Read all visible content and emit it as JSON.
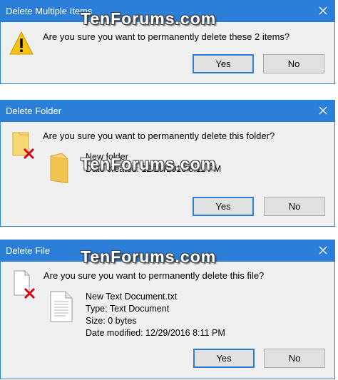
{
  "watermark": "TenForums.com",
  "dialogs": [
    {
      "title": "Delete Multiple Items",
      "question": "Are you sure you want to permanently delete these 2 items?",
      "yes": "Yes",
      "no": "No"
    },
    {
      "title": "Delete Folder",
      "question": "Are you sure you want to permanently delete this folder?",
      "item_name": "New folder",
      "date_created": "Date created: 12/29/2016 8:11 PM",
      "yes": "Yes",
      "no": "No"
    },
    {
      "title": "Delete File",
      "question": "Are you sure you want to permanently delete this file?",
      "item_name": "New Text Document.txt",
      "type": "Type: Text Document",
      "size": "Size: 0 bytes",
      "date_modified": "Date modified: 12/29/2016 8:11 PM",
      "yes": "Yes",
      "no": "No"
    }
  ],
  "icons": {
    "close": "close-icon",
    "warning": "warning-icon",
    "delete_folder": "folder-delete-icon",
    "delete_file": "file-delete-icon",
    "folder": "folder-icon",
    "text_file": "text-document-icon"
  },
  "colors": {
    "titlebar": "#2b7fd8",
    "dialog_bg": "#f0f0f0",
    "button_bg": "#e1e1e1",
    "default_border": "#2b7fd8",
    "red_x": "#d0021b",
    "warning": "#f5c211"
  }
}
